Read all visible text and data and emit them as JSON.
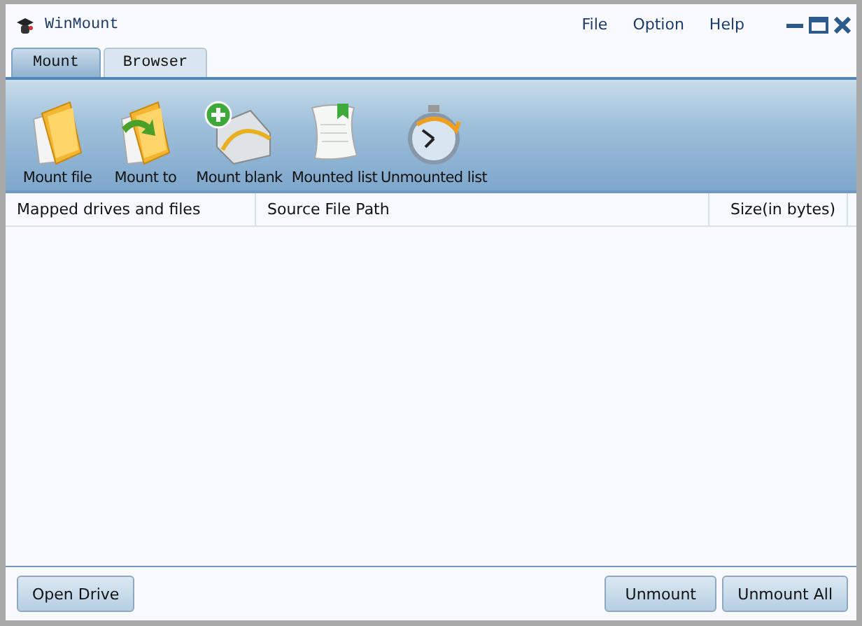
{
  "window": {
    "title": "WinMount"
  },
  "menu": [
    "File",
    "Option",
    "Help"
  ],
  "tabs": [
    {
      "label": "Mount",
      "selected": true
    },
    {
      "label": "Browser",
      "selected": false
    }
  ],
  "toolbar": [
    {
      "label": "Mount file",
      "kind": "folder"
    },
    {
      "label": "Mount to",
      "kind": "folder-arrow"
    },
    {
      "label": "Mount blank",
      "kind": "drive"
    },
    {
      "label": "Mounted list",
      "kind": "list"
    },
    {
      "label": "Unmounted list",
      "kind": "clock"
    }
  ],
  "table": {
    "columns": [
      "Mapped drives and files",
      "Source File Path",
      "Size(in bytes)"
    ]
  },
  "buttons_left": [
    "Open Drive"
  ],
  "buttons_right": [
    "Unmount",
    "Unmount All"
  ]
}
